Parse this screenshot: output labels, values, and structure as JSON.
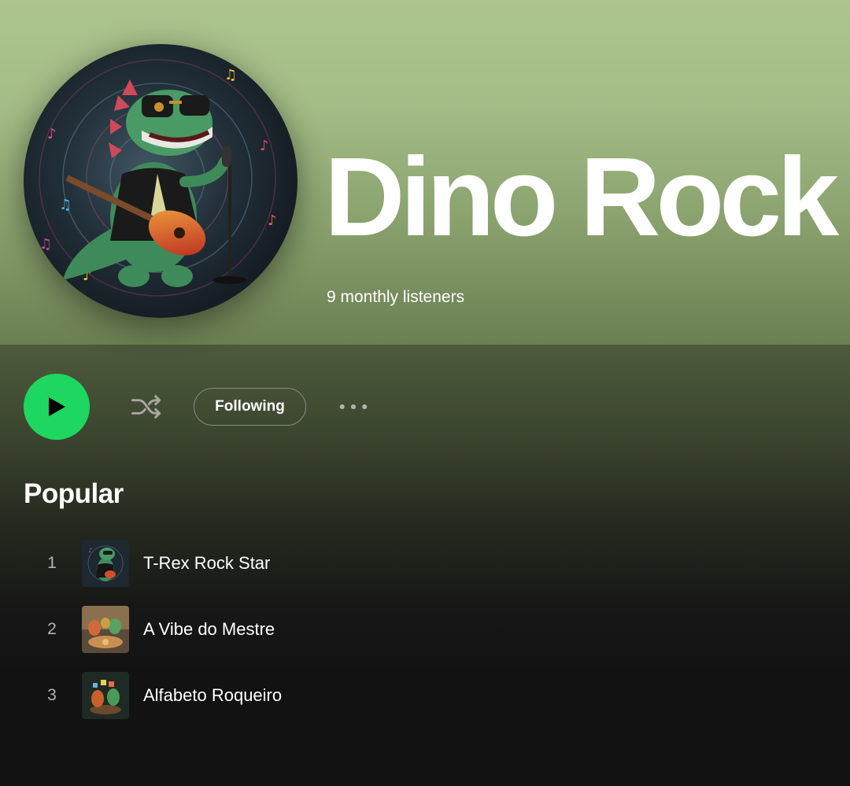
{
  "artist": {
    "name": "Dino Rock",
    "monthly_listeners": "9 monthly listeners",
    "image_icon": "dinosaur-guitarist-avatar"
  },
  "controls": {
    "play_icon": "play-icon",
    "shuffle_icon": "shuffle-icon",
    "following_label": "Following",
    "more_icon": "more-options-icon",
    "play_color": "#1ed760"
  },
  "popular": {
    "heading": "Popular",
    "tracks": [
      {
        "number": "1",
        "title": "T-Rex Rock Star",
        "cover_icon": "trex-cover-art"
      },
      {
        "number": "2",
        "title": "A Vibe do Mestre",
        "cover_icon": "dinos-table-cover-art"
      },
      {
        "number": "3",
        "title": "Alfabeto Roqueiro",
        "cover_icon": "dino-letters-cover-art"
      }
    ]
  },
  "colors": {
    "hero_top": "#acc48d",
    "hero_bottom": "#6b7f52",
    "background": "#121212",
    "accent_green": "#1ed760",
    "muted_text": "#b3b3b3"
  }
}
